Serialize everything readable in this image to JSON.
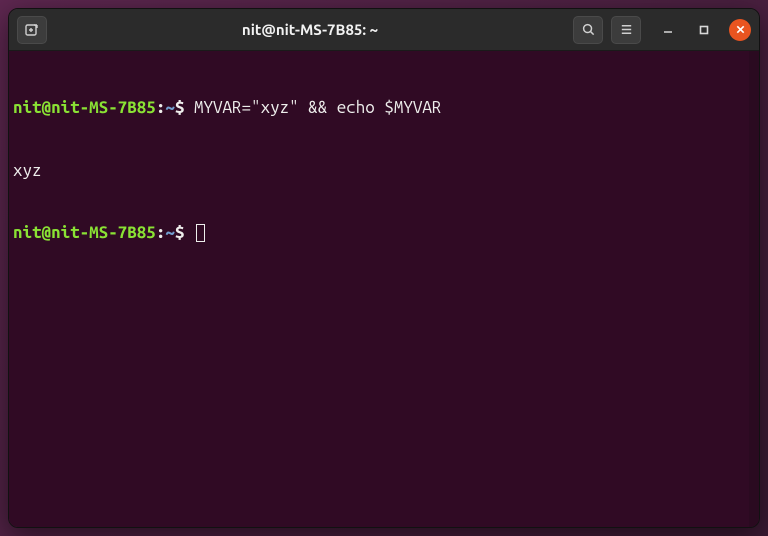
{
  "titlebar": {
    "title": "nit@nit-MS-7B85: ~"
  },
  "prompt": {
    "user_host": "nit@nit-MS-7B85",
    "separator": ":",
    "path": "~",
    "symbol": "$"
  },
  "lines": {
    "cmd1": "MYVAR=\"xyz\" && echo $MYVAR",
    "out1": "xyz"
  },
  "icons": {
    "new_tab": "new-tab-icon",
    "search": "search-icon",
    "menu": "hamburger-icon",
    "minimize": "minimize-icon",
    "maximize": "maximize-icon",
    "close": "close-icon"
  },
  "colors": {
    "terminal_bg": "#300a24",
    "prompt_user": "#8ae234",
    "prompt_path": "#729fcf",
    "text": "#eeeeec",
    "close_btn": "#e95420"
  }
}
